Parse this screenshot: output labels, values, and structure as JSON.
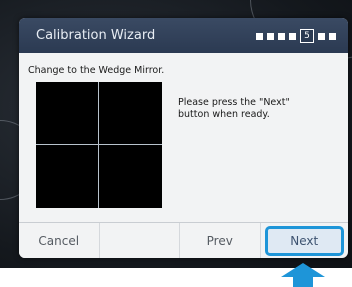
{
  "dialog": {
    "title": "Calibration Wizard",
    "current_step": "5",
    "instruction": "Change to the Wedge Mirror.",
    "prompt": "Please press the \"Next\" button when ready."
  },
  "buttons": {
    "cancel": "Cancel",
    "blank": "",
    "prev": "Prev",
    "next": "Next"
  },
  "colors": {
    "titlebar": "#2b3a52",
    "highlight": "#1e95d8"
  }
}
